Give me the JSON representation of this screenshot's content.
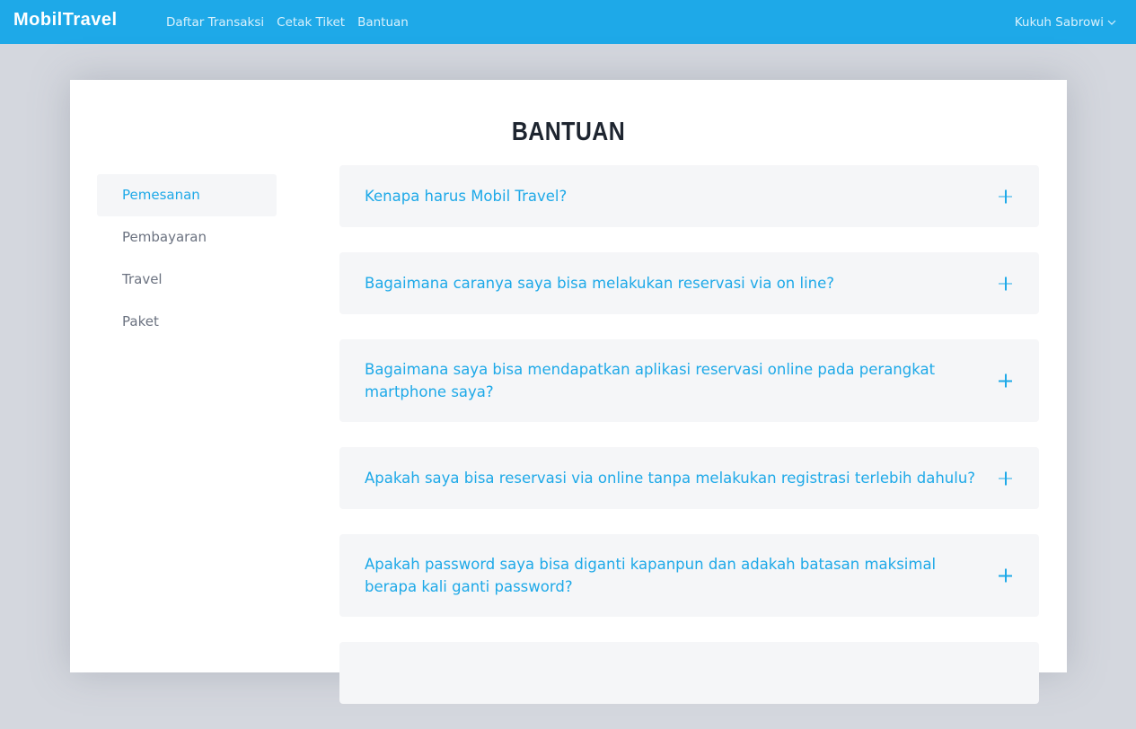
{
  "brand": {
    "name": "MobilTravel",
    "accent": "#1ea9e8"
  },
  "nav": {
    "items": [
      {
        "label": "Daftar Transaksi"
      },
      {
        "label": "Cetak Tiket"
      },
      {
        "label": "Bantuan"
      }
    ],
    "user_name": "Kukuh Sabrowi"
  },
  "page": {
    "title": "BANTUAN"
  },
  "sidebar": {
    "items": [
      {
        "label": "Pemesanan",
        "active": true
      },
      {
        "label": "Pembayaran"
      },
      {
        "label": "Travel"
      },
      {
        "label": "Paket"
      }
    ]
  },
  "faq": {
    "items": [
      {
        "question": "Kenapa harus Mobil Travel?"
      },
      {
        "question": "Bagaimana caranya saya bisa melakukan reservasi via on line?"
      },
      {
        "question": "Bagaimana saya bisa mendapatkan aplikasi reservasi online pada perangkat martphone saya?"
      },
      {
        "question": "Apakah saya bisa reservasi via online tanpa melakukan registrasi terlebih dahulu?"
      },
      {
        "question": "Apakah password saya bisa diganti kapanpun dan adakah batasan maksimal berapa kali ganti password?"
      }
    ]
  }
}
